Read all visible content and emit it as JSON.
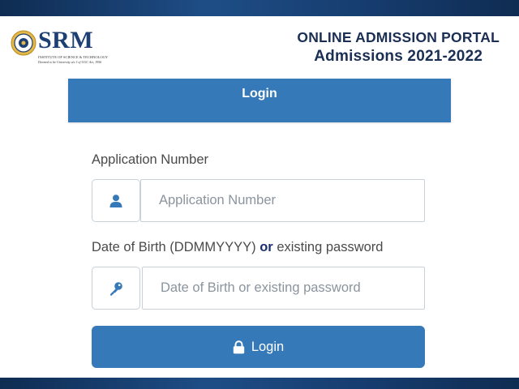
{
  "header": {
    "logo_text": "SRM",
    "logo_subline_1": "INSTITUTE OF SCIENCE & TECHNOLOGY",
    "logo_subline_2": "Deemed to be University u/s 3 of UGC Act, 1956",
    "portal_title": "ONLINE ADMISSION PORTAL",
    "portal_subtitle": "Admissions 2021-2022"
  },
  "card": {
    "title": "Login"
  },
  "form": {
    "application_number": {
      "label": "Application Number",
      "placeholder": "Application Number",
      "value": "",
      "icon": "user-icon"
    },
    "password": {
      "label_part1": "Date of Birth (DDMMYYYY)",
      "label_or": "or",
      "label_part2": "existing password",
      "placeholder": "Date of Birth or existing password",
      "value": "",
      "icon": "key-icon"
    },
    "submit": {
      "label": "Login",
      "icon": "lock-icon"
    }
  },
  "colors": {
    "primary": "#3579b8",
    "band": "#1a4478",
    "title": "#1b2f55"
  }
}
